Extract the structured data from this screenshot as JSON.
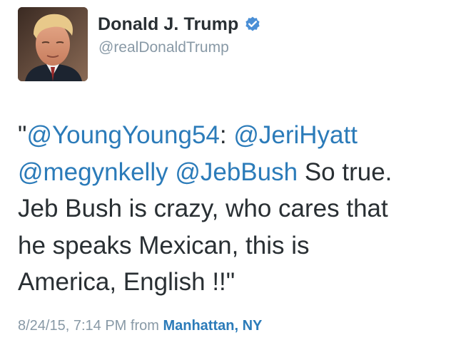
{
  "author": {
    "display_name": "Donald J. Trump",
    "handle": "@realDonaldTrump",
    "avatar_icon": "profile-photo",
    "verified_icon": "verified-badge-icon",
    "verified_color": "#4a8fd6"
  },
  "tweet": {
    "segments": [
      {
        "text": "\"",
        "type": "text"
      },
      {
        "text": "@YoungYoung54",
        "type": "mention"
      },
      {
        "text": ":  ",
        "type": "text"
      },
      {
        "text": "@JeriHyatt",
        "type": "mention"
      },
      {
        "text": "\n",
        "type": "text"
      },
      {
        "text": "@megynkelly",
        "type": "mention"
      },
      {
        "text": " ",
        "type": "text"
      },
      {
        "text": "@JebBush",
        "type": "mention"
      },
      {
        "text": " So true.\nJeb Bush is crazy, who cares that\nhe speaks Mexican, this is\nAmerica, English !!\"",
        "type": "text"
      }
    ],
    "mention_color": "#2b7bb9",
    "text_color": "#292f33"
  },
  "meta": {
    "timestamp": "8/24/15, 7:14 PM",
    "from_label": "from",
    "location": "Manhattan, NY"
  }
}
